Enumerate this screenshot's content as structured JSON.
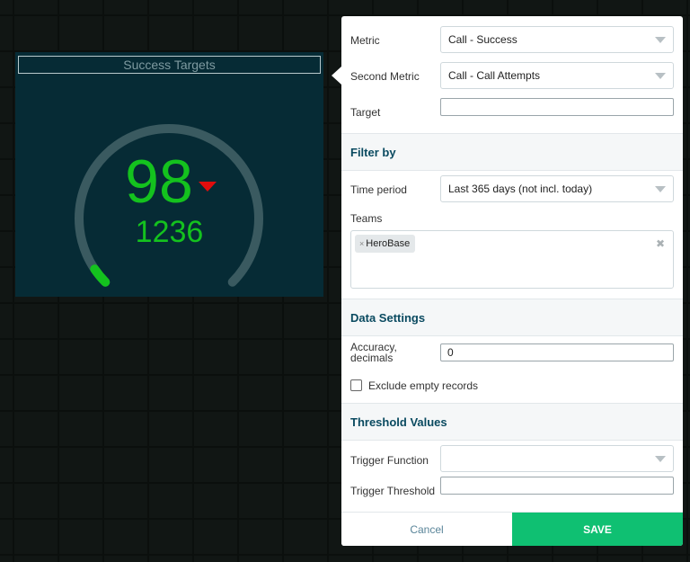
{
  "widget": {
    "title": "Success Targets",
    "value": "98",
    "second_value": "1236",
    "trend": "down",
    "gauge_progress": 0.04,
    "colors": {
      "value": "#14c21e",
      "arrow": "#e00d0d",
      "track": "#3a5a60",
      "background": "#062b35"
    }
  },
  "settings": {
    "metric_label": "Metric",
    "metric_value": "Call - Success",
    "second_metric_label": "Second Metric",
    "second_metric_value": "Call - Call Attempts",
    "target_label": "Target",
    "target_value": "",
    "filter": {
      "header": "Filter by",
      "time_period_label": "Time period",
      "time_period_value": "Last 365 days (not incl. today)",
      "teams_label": "Teams",
      "teams": [
        "HeroBase"
      ]
    },
    "data_settings": {
      "header": "Data Settings",
      "accuracy_label_line1": "Accuracy,",
      "accuracy_label_line2": "decimals",
      "accuracy_value": "0",
      "exclude_empty_label": "Exclude empty records",
      "exclude_empty_checked": false
    },
    "threshold": {
      "header": "Threshold Values",
      "trigger_function_label": "Trigger Function",
      "trigger_function_value": "",
      "trigger_threshold_label": "Trigger Threshold",
      "trigger_threshold_value": ""
    },
    "buttons": {
      "cancel": "Cancel",
      "save": "SAVE"
    },
    "colors": {
      "save": "#0fc072",
      "section_header": "#0a4a60"
    }
  }
}
